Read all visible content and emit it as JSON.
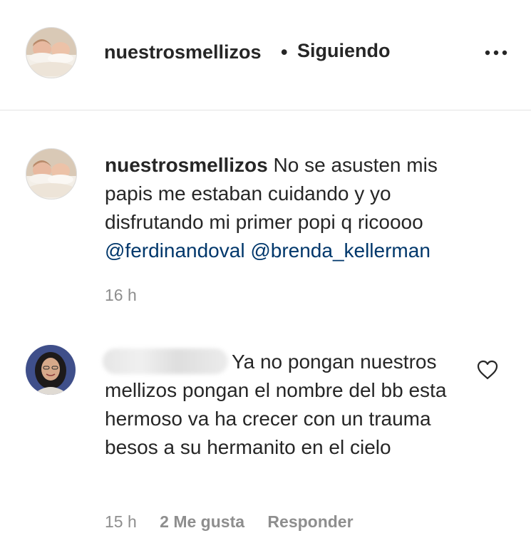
{
  "header": {
    "username": "nuestrosmellizos",
    "separator": "•",
    "follow_status": "Siguiendo",
    "more_icon": "more-horizontal-icon"
  },
  "comments": [
    {
      "username": "nuestrosmellizos",
      "text": "No se asusten mis papis me estaban cuidando y yo disfrutando mi primer popi q ricoooo",
      "mentions": [
        "@ferdinandoval",
        "@brenda_kellerman"
      ],
      "time": "16 h"
    },
    {
      "username_hidden": true,
      "text": "Ya no pongan nuestros mellizos pongan el nombre del bb esta hermoso va ha crecer con un trauma besos a su hermanito en el cielo",
      "time": "15 h",
      "likes": "2 Me gusta",
      "reply": "Responder",
      "like_icon": "heart-outline-icon"
    }
  ],
  "colors": {
    "text": "#262626",
    "secondary": "#8e8e8e",
    "mention": "#00376b",
    "divider": "#e3e3e3"
  }
}
